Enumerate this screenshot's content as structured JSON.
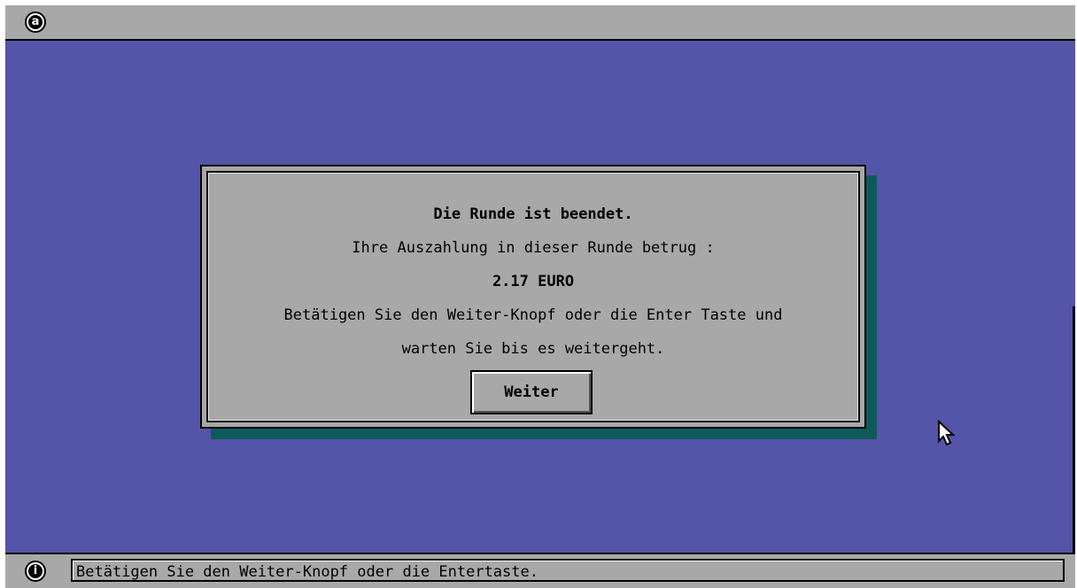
{
  "topbar": {
    "app_icon_letter": "a",
    "app_icon_name": "app-menu-icon"
  },
  "dialog": {
    "title": "Die Runde ist beendet.",
    "line1": "Ihre Auszahlung in dieser Runde betrug :",
    "amount": "2.17 EURO",
    "line2": "Betätigen Sie den Weiter-Knopf oder die Enter Taste und",
    "line3": "warten Sie bis es weitergeht.",
    "button_label": "Weiter"
  },
  "statusbar": {
    "info_icon_letter": "i",
    "text": "Betätigen Sie den Weiter-Knopf oder die Entertaste."
  },
  "colors": {
    "desktop": "#5454a8",
    "panel": "#a8a8a8",
    "shadow": "#0e5a5a"
  },
  "icons": {
    "app": "app-menu-icon",
    "info": "info-icon",
    "pointer": "mouse-pointer-icon"
  }
}
